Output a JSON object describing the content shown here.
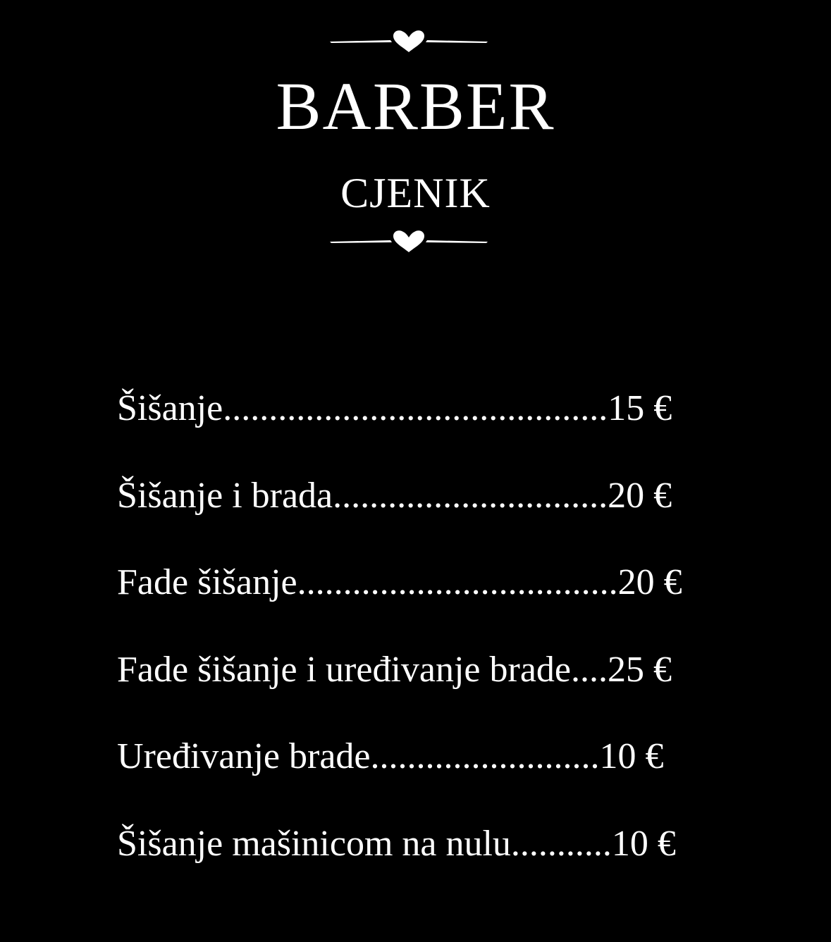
{
  "header": {
    "title": "BARBER",
    "subtitle": "CJENIK",
    "ornament_icon": "heart-divider-icon"
  },
  "price_list": [
    {
      "text": "Šišanje..........................................15 €"
    },
    {
      "text": "Šišanje i brada..............................20 €"
    },
    {
      "text": "Fade šišanje...................................20 €"
    },
    {
      "text": "Fade šišanje i uređivanje brade....25 €"
    },
    {
      "text": "Uređivanje brade.........................10 €"
    },
    {
      "text": "Šišanje mašinicom na nulu...........10 €"
    }
  ],
  "colors": {
    "background": "#000000",
    "text": "#ffffff"
  }
}
